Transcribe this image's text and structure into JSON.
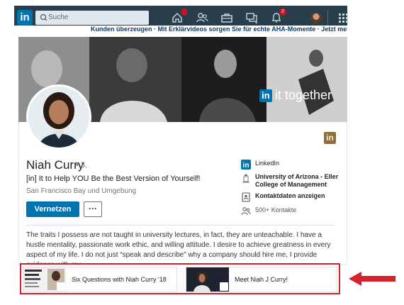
{
  "nav": {
    "logo_text": "in",
    "search_placeholder": "Suche",
    "home_badge": "",
    "notifications_badge": "2",
    "icons": [
      "home-icon",
      "network-icon",
      "jobs-icon",
      "messaging-icon",
      "notifications-icon",
      "me-avatar",
      "apps-grid-icon"
    ]
  },
  "ticker": "Kunden überzeugen · Mit Erklärvideos sorgen Sie für echte AHA-Momente · Jetzt mehr",
  "banner": {
    "in_text": "in",
    "tagline": "it together"
  },
  "profile": {
    "name": "Niah Curry",
    "degree": "• 3.",
    "headline": "[in] It to Help YOU Be the Best Version of Yourself!",
    "location": "San Francisco Bay und Umgebung",
    "connect_label": "Vernetzen",
    "more_label": "···",
    "badge_text": "in"
  },
  "side": {
    "company": "LinkedIn",
    "school": "University of Arizona - Eller College of Management",
    "contact": "Kontaktdaten anzeigen",
    "connections": "500+ Kontakte"
  },
  "about": "The traits I possess are not taught in university lectures, in fact, they are unteachable. I have a hustle mentality, passionate work ethic, and willing attitude. I desire to achieve greatness in every aspect of my life. I do not just “speak and describe” why a company should hire me, I provide evidence with my...",
  "media": [
    {
      "title": "Six Questions with Niah Curry '18",
      "type": "document-icon"
    },
    {
      "title": "Meet Niah J Curry!",
      "type": "video-icon"
    }
  ],
  "colors": {
    "nav_bg": "#283e4a",
    "linkedin_blue": "#0073b1",
    "highlight_red": "#d8222b",
    "premium_gold": "#8d6e3f"
  }
}
